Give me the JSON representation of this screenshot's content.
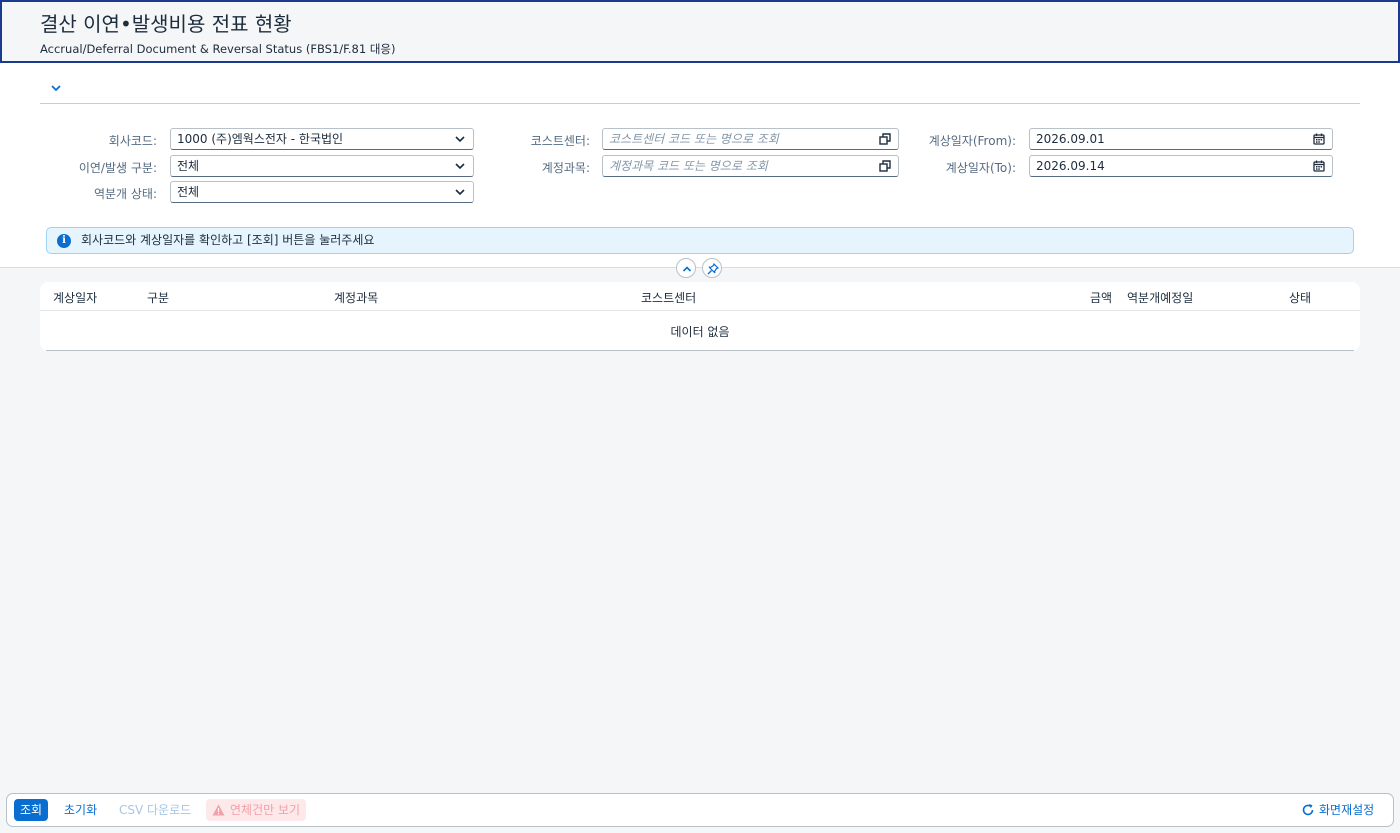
{
  "header": {
    "title": "결산 이연•발생비용 전표 현황",
    "subtitle": "Accrual/Deferral Document & Reversal Status (FBS1/F.81 대응)"
  },
  "filters": {
    "company_code": {
      "label": "회사코드:",
      "value": "1000 (주)엠웍스전자 - 한국법인"
    },
    "type": {
      "label": "이연/발생 구분:",
      "value": "전체"
    },
    "reversal_status": {
      "label": "역분개 상태:",
      "value": "전체"
    },
    "cost_center": {
      "label": "코스트센터:",
      "placeholder": "코스트센터 코드 또는 명으로 조회"
    },
    "gl_account": {
      "label": "계정과목:",
      "placeholder": "계정과목 코드 또는 명으로 조회"
    },
    "date_from": {
      "label": "계상일자(From):",
      "value": "2026.09.01"
    },
    "date_to": {
      "label": "계상일자(To):",
      "value": "2026.09.14"
    }
  },
  "message": {
    "text": "회사코드와 계상일자를 확인하고 [조회] 버튼을 눌러주세요"
  },
  "table": {
    "columns": [
      "계상일자",
      "구분",
      "계정과목",
      "코스트센터",
      "금액",
      "역분개예정일",
      "상태"
    ],
    "no_data": "데이터 없음"
  },
  "footer": {
    "search": "조회",
    "reset": "초기화",
    "csv": "CSV 다운로드",
    "overdue_only": "연체건만 보기",
    "reset_layout": "화면재설정"
  },
  "colors": {
    "accent": "#0a6ed1",
    "header_border": "#1a3a8f",
    "info_bg": "#e5f4fd",
    "warning_bg": "#fde8ea"
  }
}
